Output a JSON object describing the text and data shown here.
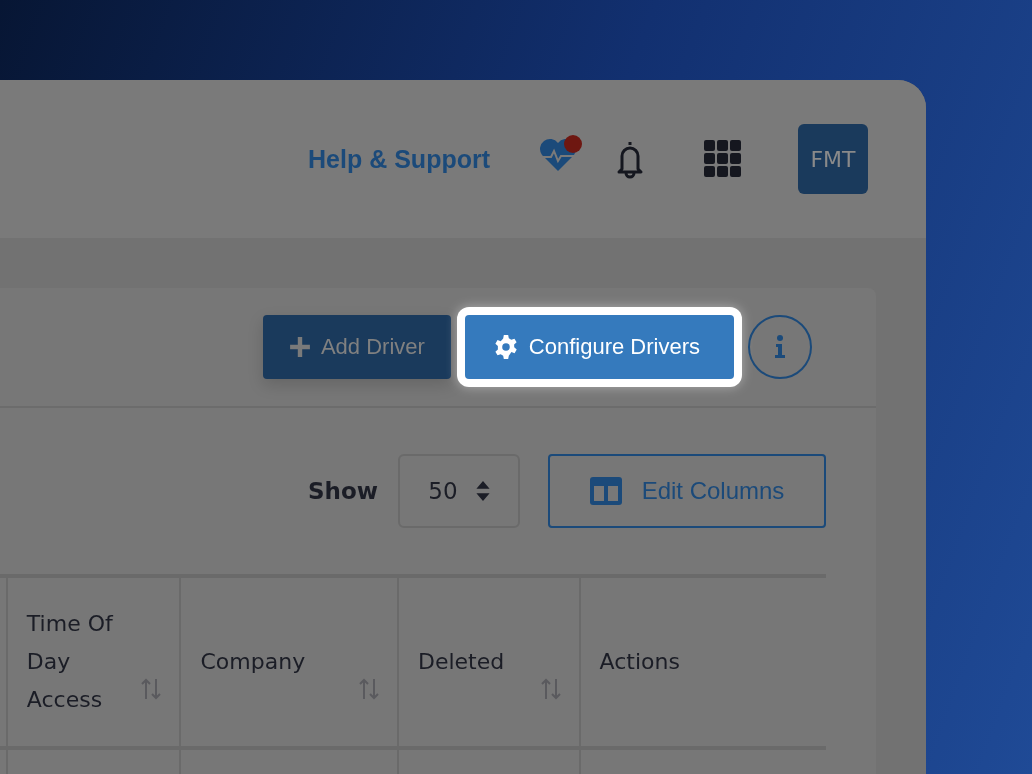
{
  "header": {
    "help_link": "Help & Support",
    "health_alert": true,
    "avatar": "FMT"
  },
  "toolbar": {
    "buttons": [
      {
        "label": "Add Driver",
        "kind": "add",
        "highlighted": false
      },
      {
        "label": "Configure Drivers",
        "kind": "configure",
        "highlighted": true
      }
    ]
  },
  "list_controls": {
    "show_label": "Show",
    "page_size": "50",
    "edit_columns": "Edit Columns"
  },
  "table": {
    "columns": [
      {
        "label": "Time Of Day Access",
        "sortable": true
      },
      {
        "label": "Company",
        "sortable": true
      },
      {
        "label": "Deleted",
        "sortable": true
      },
      {
        "label": "Actions",
        "sortable": false
      }
    ]
  }
}
